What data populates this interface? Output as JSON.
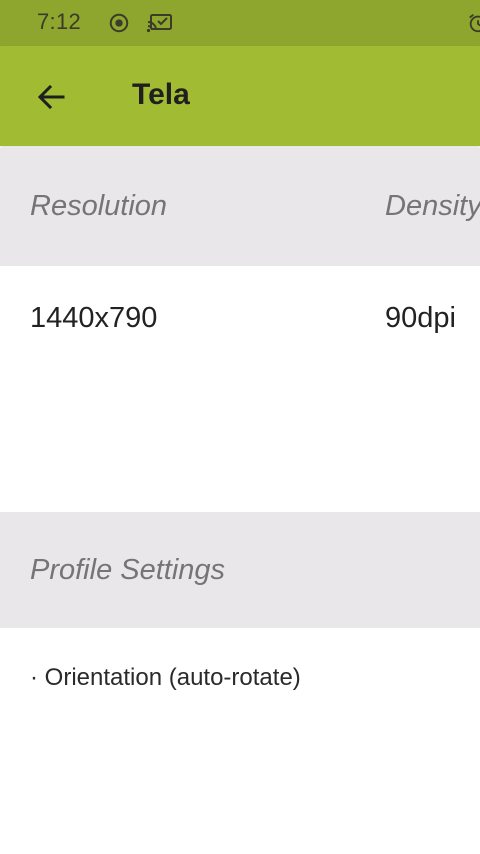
{
  "status_bar": {
    "time": "7:12",
    "icons": [
      "record-icon",
      "cast-icon",
      "alarm-icon"
    ]
  },
  "app_bar": {
    "title": "Tela",
    "back_icon": "arrow-left-icon"
  },
  "display_section": {
    "columns": [
      {
        "header": "Resolution",
        "value": "1440x790"
      },
      {
        "header": "Density",
        "value": "90dpi"
      }
    ]
  },
  "profile_section": {
    "header": "Profile Settings",
    "items": [
      {
        "label": "· Orientation (auto-rotate)"
      }
    ]
  },
  "colors": {
    "status_bar": "#8ea52e",
    "app_bar": "#a1bb33",
    "section_header_bg": "#e9e7ea",
    "section_header_text": "#757575"
  }
}
